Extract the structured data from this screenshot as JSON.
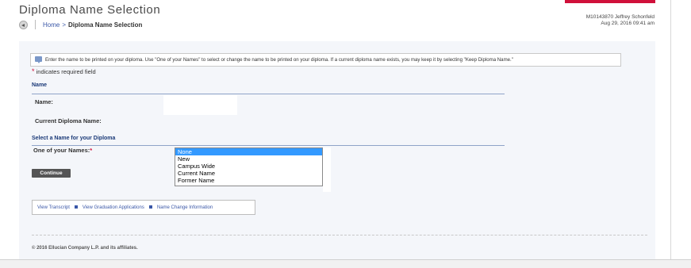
{
  "header": {
    "title": "Diploma Name Selection",
    "breadcrumb": {
      "home": "Home",
      "separator": ">",
      "current": "Diploma Name Selection"
    },
    "user": {
      "id_name": "M10143870 Jeffrey Schonfeld",
      "datetime": "Aug 29, 2016 09:41 am"
    },
    "brand_color": "#d0103a"
  },
  "info": {
    "icon": "info-message-icon",
    "text": "Enter the name to be printed on your diploma. Use \"One of your Names\" to select or change the name to be printed on your diploma. If a current diploma name exists, you may keep it by selecting \"Keep Diploma Name.\""
  },
  "required_note": {
    "star": "*",
    "text": "indicates required field"
  },
  "name_section": {
    "heading": "Name",
    "name_label": "Name:",
    "current_diploma_label": "Current Diploma Name:"
  },
  "select_section": {
    "heading": "Select a Name for your Diploma",
    "label": "One of your Names:",
    "required_star": "*",
    "options": [
      "None",
      "New",
      "Campus Wide",
      "Current Name",
      "Former Name"
    ],
    "selected": "None"
  },
  "continue_label": "Continue",
  "links": {
    "transcript": "View Transcript",
    "graduation": "View Graduation Applications",
    "name_change": "Name Change Information"
  },
  "footer": {
    "copyright": "© 2016 Ellucian Company L.P. and its affiliates."
  }
}
